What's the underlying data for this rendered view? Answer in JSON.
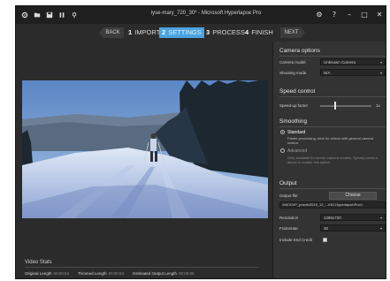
{
  "window": {
    "title": "lyse-mary_720_30* - Microsoft Hyperlapse Pro",
    "controls": {
      "settings": "⚙",
      "help": "?",
      "minimize": "–",
      "maximize": "□",
      "close": "✕"
    }
  },
  "wizard": {
    "back_label": "BACK",
    "next_label": "NEXT",
    "steps": [
      {
        "num": "1",
        "label": "IMPORT"
      },
      {
        "num": "2",
        "label": "SETTINGS"
      },
      {
        "num": "3",
        "label": "PROCESS"
      },
      {
        "num": "4",
        "label": "FINISH"
      }
    ],
    "active_step": "SETTINGS"
  },
  "video_stats": {
    "title": "Video Stats",
    "original_label": "Original Length",
    "original_value": "00:00:53",
    "trimmed_label": "Trimmed Length",
    "trimmed_value": "00:00:53",
    "estimated_label": "Estimated Output Length",
    "estimated_value": "00:00:05"
  },
  "camera_options": {
    "title": "Camera options",
    "model_label": "Camera model",
    "model_value": "Unknown Camera",
    "mode_label": "Shooting mode",
    "mode_value": "N/A"
  },
  "speed_control": {
    "title": "Speed control",
    "factor_label": "Speed-up factor",
    "factor_value": "1x",
    "slider_level": 0.27
  },
  "smoothing": {
    "title": "Smoothing",
    "standard_label": "Standard",
    "standard_desc": "Faster processing, best for videos with general camera motion.",
    "advanced_label": "Advanced",
    "advanced_desc": "Only available for known camera models. Specify camera above to enable this option.",
    "selected": "Standard"
  },
  "output": {
    "title": "Output",
    "file_label": "Output file",
    "choose_label": "Choose",
    "file_path": "\\\\NEXIVP_praxis\\2019_12_...\\HD-Hyperlapse\\Pro\\1",
    "resolution_label": "Resolution",
    "resolution_value": "1280x720",
    "framerate_label": "Framerate",
    "framerate_value": "30",
    "credit_label": "Include End Credit",
    "credit_checked": true
  },
  "colors": {
    "accent": "#4aa3df",
    "window_bg": "#2b2b2b",
    "panel_bg": "#333333",
    "titlebar_bg": "#1f1f1f"
  },
  "icons": {
    "titlebar": [
      "settings-gear-icon",
      "folder-icon",
      "save-icon",
      "pause-icon",
      "extra-icon"
    ],
    "caret": "▾"
  }
}
